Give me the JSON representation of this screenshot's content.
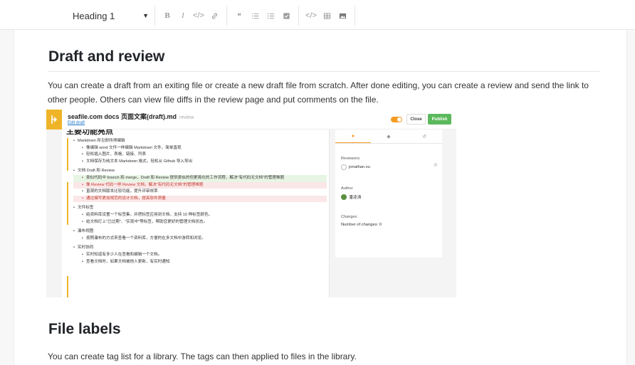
{
  "toolbar": {
    "heading_select": "Heading 1",
    "buttons": [
      {
        "name": "bold-button",
        "glyph": "B"
      },
      {
        "name": "italic-button",
        "glyph": "I"
      },
      {
        "name": "inline-code-button",
        "glyph": "</>"
      },
      {
        "name": "link-button",
        "glyph": "🔗"
      },
      {
        "name": "quote-button",
        "glyph": "❝"
      },
      {
        "name": "ordered-list-button",
        "glyph": "≡"
      },
      {
        "name": "unordered-list-button",
        "glyph": "☰"
      },
      {
        "name": "checklist-button",
        "glyph": "☑"
      },
      {
        "name": "code-block-button",
        "glyph": "</>"
      },
      {
        "name": "table-button",
        "glyph": "▦"
      },
      {
        "name": "image-button",
        "glyph": "▣"
      }
    ]
  },
  "document": {
    "section1": {
      "title": "Draft and review",
      "body": "You can create a draft from an exiting file or create a new draft file from scratch. After done editing, you can create a review and send the link to other people. Others can view file diffs in the review page and put comments on the file."
    },
    "section2": {
      "title": "File labels",
      "body": "You can create tag list for a library. The tags can then applied to files in the library."
    }
  },
  "screenshot": {
    "title": "seafile.com docs 页面文案(draft).md",
    "status": "review",
    "subtitle": "Edit draft",
    "close_label": "Close",
    "publish_label": "Publish",
    "doc_heading": "主要功能亮点",
    "list": [
      {
        "level": 1,
        "text": "Markdown 所见即所得编辑"
      },
      {
        "level": 2,
        "text": "像编辑 word 文件一样编辑 Markdown 文件，简单直观"
      },
      {
        "level": 2,
        "text": "轻松插入图片、表格、链接、列表"
      },
      {
        "level": 2,
        "text": "文档保存为纯文本 Markdown 格式，轻松从 Github 导入导出"
      },
      {
        "level": 1,
        "text": "文档 Draft 和 Review",
        "gap": true
      },
      {
        "level": 2,
        "text": "类似代码中 branch 和 merge，Draft 和 Review 提供类似的但更简化的工作流程，解决\"有代码无文档\"的管理难题",
        "style": "green"
      },
      {
        "level": 2,
        "text": "像 Review 代码一样 Review 文档，解决\"有代码无文档\"的管理难题",
        "style": "red"
      },
      {
        "level": 2,
        "text": "直观的文档版本比较功能，提升评审效率"
      },
      {
        "level": 2,
        "text": "通过编写更加规范的设计文档，提高软件质量",
        "style": "red"
      },
      {
        "level": 1,
        "text": "文件标签",
        "gap": true
      },
      {
        "level": 2,
        "text": "给资料库设置一个标签集，并把标签应用到文档，支持 10 种标签颜色。"
      },
      {
        "level": 2,
        "text": "给文档打上\"已过期\"、\"实现中\"等标签，帮助您更好的管理文档状态。"
      },
      {
        "level": 1,
        "text": "瀑布视图",
        "gap": true
      },
      {
        "level": 2,
        "text": "按照瀑布的方式来查看一个资料库，方便的在多文档中游转和浏览。"
      },
      {
        "level": 1,
        "text": "实时协同",
        "gap": true
      },
      {
        "level": 2,
        "text": "实时知道有多少人在查看和编辑一个文档。"
      },
      {
        "level": 2,
        "text": "查看文档时，如果文档被他人更新，有实时通知"
      }
    ],
    "side": {
      "reviewers_label": "Reviewers",
      "reviewer": "jonathan.xu",
      "author_label": "Author",
      "author": "潘凌涛",
      "changes_label": "Changes",
      "changes_text": "Number of changes: 0"
    }
  },
  "colors": {
    "accent": "#f59b23",
    "publish": "#5cb85c",
    "logo": "#f0b429"
  }
}
